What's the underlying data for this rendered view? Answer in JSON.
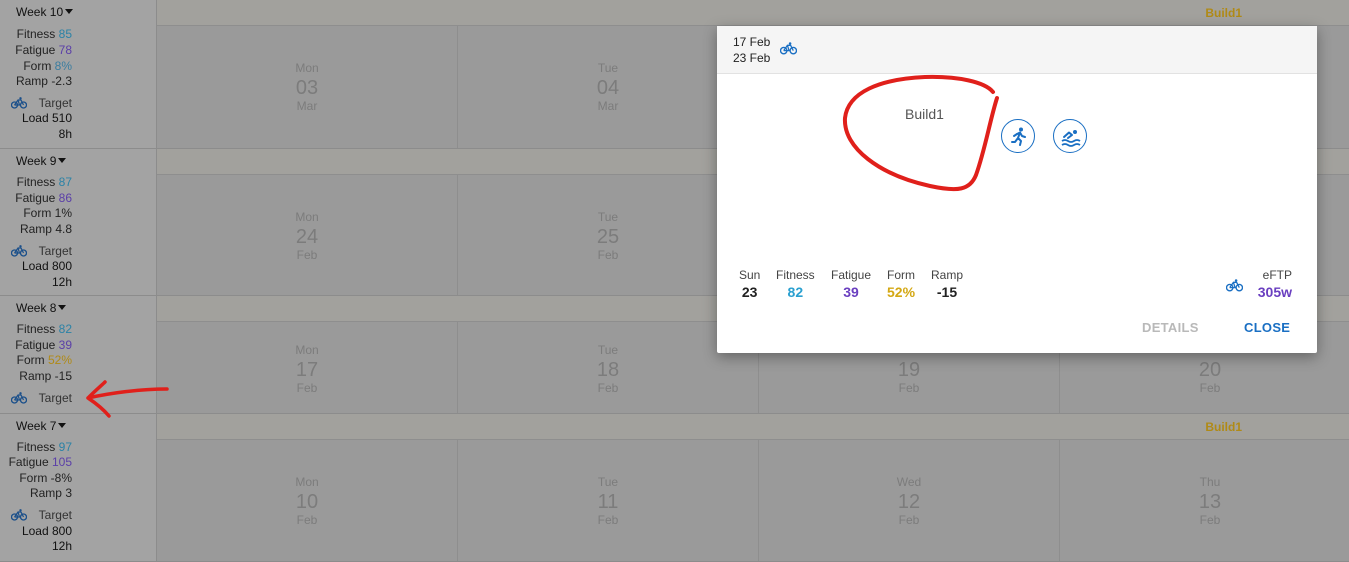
{
  "colors": {
    "fitness": "#2b82a6",
    "fatigue": "#5b3fa8",
    "form_positive": "#b08a16",
    "accent": "#1a6fc3",
    "plan_label": "#b08a16",
    "annotation": "#e0201b"
  },
  "weeks": [
    {
      "title": "Week 10",
      "fitness_label": "Fitness",
      "fitness": "85",
      "fatigue_label": "Fatigue",
      "fatigue": "78",
      "form_label": "Form",
      "form": "8%",
      "ramp_label": "Ramp",
      "ramp": "-2.3",
      "target_label": "Target",
      "load": "Load 510",
      "hours": "8h",
      "plan": "Build1",
      "days": [
        {
          "dow": "Mon",
          "num": "03",
          "mon": "Mar"
        },
        {
          "dow": "Tue",
          "num": "04",
          "mon": "Mar"
        }
      ]
    },
    {
      "title": "Week 9",
      "fitness_label": "Fitness",
      "fitness": "87",
      "fatigue_label": "Fatigue",
      "fatigue": "86",
      "form_label": "Form",
      "form": "1%",
      "ramp_label": "Ramp",
      "ramp": "4.8",
      "target_label": "Target",
      "load": "Load 800",
      "hours": "12h",
      "days": [
        {
          "dow": "Mon",
          "num": "24",
          "mon": "Feb"
        },
        {
          "dow": "Tue",
          "num": "25",
          "mon": "Feb"
        }
      ]
    },
    {
      "title": "Week 8",
      "fitness_label": "Fitness",
      "fitness": "82",
      "fatigue_label": "Fatigue",
      "fatigue": "39",
      "form_label": "Form",
      "form": "52%",
      "ramp_label": "Ramp",
      "ramp": "-15",
      "target_label": "Target",
      "days": [
        {
          "dow": "Mon",
          "num": "17",
          "mon": "Feb"
        },
        {
          "dow": "Tue",
          "num": "18",
          "mon": "Feb"
        },
        {
          "dow": "",
          "num": "19",
          "mon": "Feb"
        },
        {
          "dow": "",
          "num": "20",
          "mon": "Feb"
        }
      ]
    },
    {
      "title": "Week 7",
      "fitness_label": "Fitness",
      "fitness": "97",
      "fatigue_label": "Fatigue",
      "fatigue": "105",
      "form_label": "Form",
      "form": "-8%",
      "ramp_label": "Ramp",
      "ramp": "3",
      "target_label": "Target",
      "load": "Load 800",
      "hours": "12h",
      "plan": "Build1",
      "days": [
        {
          "dow": "Mon",
          "num": "10",
          "mon": "Feb"
        },
        {
          "dow": "Tue",
          "num": "11",
          "mon": "Feb"
        },
        {
          "dow": "Wed",
          "num": "12",
          "mon": "Feb"
        },
        {
          "dow": "Thu",
          "num": "13",
          "mon": "Feb"
        }
      ]
    }
  ],
  "dialog": {
    "date_start": "17 Feb",
    "date_end": "23 Feb",
    "plan_name": "Build1",
    "activity_icons": [
      "run-icon",
      "swim-icon"
    ],
    "metrics": [
      {
        "label": "Sun",
        "value": "23"
      },
      {
        "label": "Fitness",
        "value": "82"
      },
      {
        "label": "Fatigue",
        "value": "39"
      },
      {
        "label": "Form",
        "value": "52%"
      },
      {
        "label": "Ramp",
        "value": "-15"
      }
    ],
    "eftp_label": "eFTP",
    "eftp_value": "305w",
    "details_label": "DETAILS",
    "close_label": "CLOSE"
  }
}
